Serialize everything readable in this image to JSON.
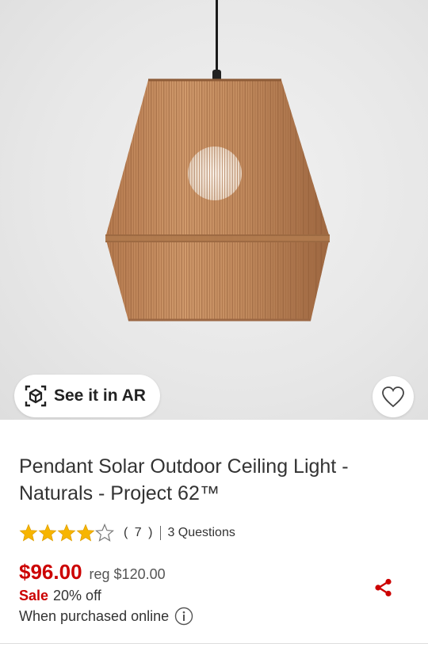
{
  "hero": {
    "ar_button_label": "See it in AR"
  },
  "product": {
    "title": "Pendant Solar Outdoor Ceiling Light - Naturals - Project 62™",
    "rating": 4,
    "rating_max": 5,
    "rating_count": "( 7 )",
    "questions": "3 Questions",
    "price": "$96.00",
    "reg_price": "reg $120.00",
    "sale_label": "Sale",
    "discount": "20% off",
    "purchased_note": "When purchased online"
  },
  "colors": {
    "accent": "#cc0000",
    "star": "#f7b500",
    "text": "#333333",
    "lamp_rattan": "#c48a5c"
  },
  "icons": {
    "ar": "ar-cube-icon",
    "favorite": "heart-outline-icon",
    "share": "share-icon",
    "info": "info-circle-icon"
  }
}
